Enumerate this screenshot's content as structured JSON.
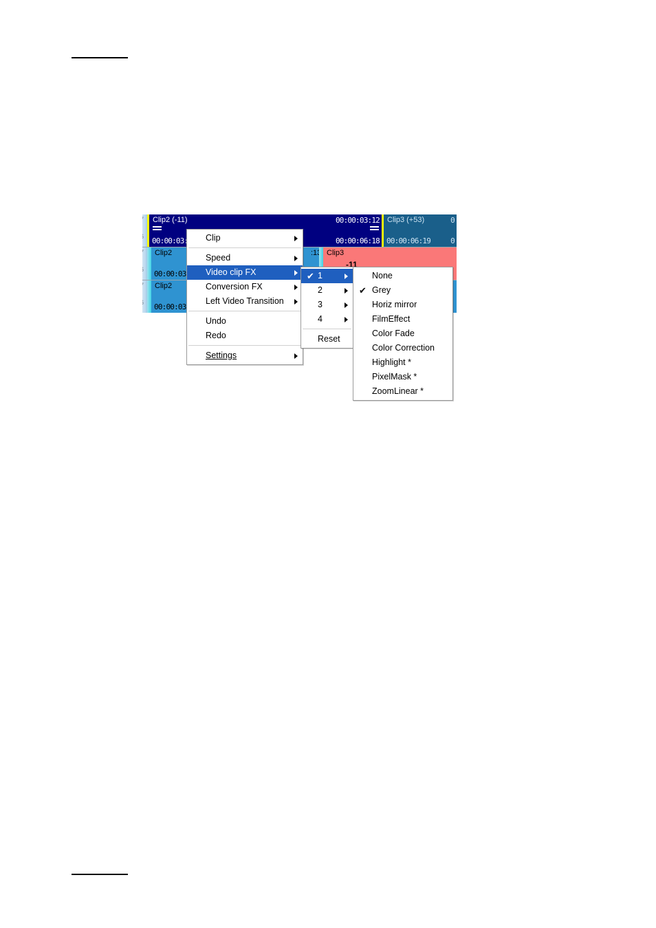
{
  "page": {
    "rules": [
      "top-rule",
      "bottom-rule"
    ]
  },
  "timeline": {
    "gutter_numbers": [
      "7",
      "6"
    ],
    "rows": [
      {
        "clips": [
          {
            "name": "Clip2 (-11)",
            "tc_top_right": "00:00:03:12",
            "tc_bottom_left": "00:00:03:0",
            "tc_bottom_right": "00:00:06:18",
            "color": "#000080",
            "text_color": "#ffffff"
          },
          {
            "name": "Clip3 (+53)",
            "tc_top_right": "0",
            "tc_bottom_left": "00:00:06:19",
            "tc_bottom_right": "0",
            "color": "#1a5f8a",
            "text_color": "#cfe4f2"
          }
        ]
      },
      {
        "clips": [
          {
            "name": "Clip2",
            "tc_bottom_left": "00:00:03:0",
            "color": "#2f93d1",
            "text_color": "#000000"
          },
          {
            "name": "Clip3",
            "tc_top_left": ":13",
            "offset_label": "-11",
            "color": "#fa7878",
            "text_color": "#000000"
          }
        ]
      },
      {
        "clips": [
          {
            "name": "Clip2",
            "tc_bottom_left": "00:00:03:0",
            "color": "#2f93d1",
            "text_color": "#000000"
          }
        ]
      }
    ],
    "colors": {
      "navy": "#000080",
      "steel_blue": "#1a5f8a",
      "light_blue": "#2f93d1",
      "salmon": "#fa7878",
      "playhead_yellow": "#ffff00",
      "aqua": "#3fd3e6"
    }
  },
  "context_menu": {
    "items": [
      {
        "label": "Clip",
        "submenu": true,
        "selected": false
      },
      {
        "separator": true
      },
      {
        "label": "Speed",
        "submenu": true,
        "selected": false
      },
      {
        "label": "Video clip FX",
        "submenu": true,
        "selected": true
      },
      {
        "label": "Conversion FX",
        "submenu": true,
        "selected": false
      },
      {
        "label": "Left Video Transition",
        "submenu": true,
        "selected": false
      },
      {
        "separator": true
      },
      {
        "label": "Undo",
        "submenu": false,
        "selected": false
      },
      {
        "label": "Redo",
        "submenu": false,
        "selected": false
      },
      {
        "separator": true
      },
      {
        "label": "Settings",
        "submenu": true,
        "selected": false,
        "accel": "S"
      }
    ]
  },
  "fx_level_menu": {
    "items": [
      {
        "label": "1",
        "submenu": true,
        "checked": true,
        "selected": true
      },
      {
        "label": "2",
        "submenu": true,
        "checked": false,
        "selected": false
      },
      {
        "label": "3",
        "submenu": true,
        "checked": false,
        "selected": false
      },
      {
        "label": "4",
        "submenu": true,
        "checked": false,
        "selected": false
      },
      {
        "separator": true
      },
      {
        "label": "Reset",
        "submenu": false,
        "checked": false,
        "selected": false
      }
    ]
  },
  "fx_effect_menu": {
    "items": [
      {
        "label": "None",
        "checked": false
      },
      {
        "label": "Grey",
        "checked": true
      },
      {
        "label": "Horiz mirror",
        "checked": false
      },
      {
        "label": "FilmEffect",
        "checked": false
      },
      {
        "label": "Color Fade",
        "checked": false
      },
      {
        "label": "Color Correction",
        "checked": false
      },
      {
        "label": "Highlight *",
        "checked": false
      },
      {
        "label": "PixelMask *",
        "checked": false
      },
      {
        "label": "ZoomLinear *",
        "checked": false
      }
    ]
  },
  "glyphs": {
    "check": "✔",
    "arrow": "▶"
  }
}
